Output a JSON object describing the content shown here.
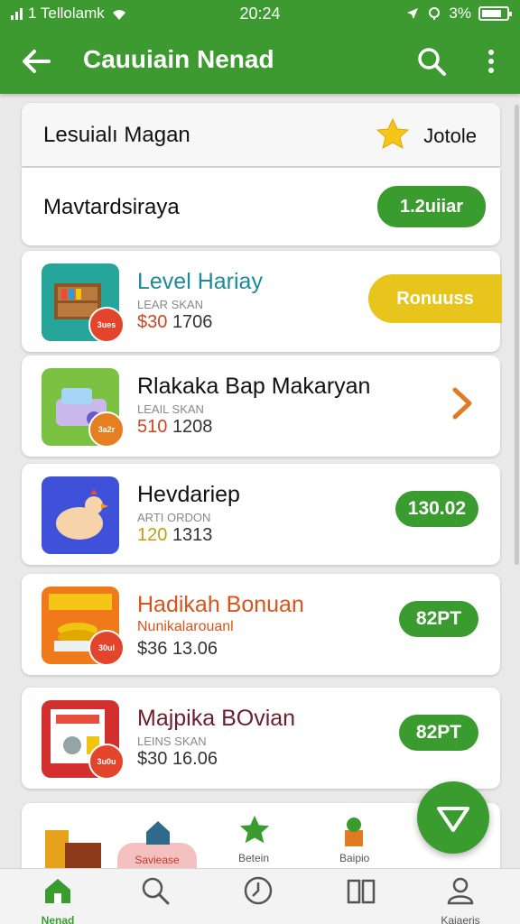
{
  "status": {
    "carrier": "1 Tellolamk",
    "time": "20:24",
    "battery": "3%",
    "battery_level": 0.8,
    "icons": [
      "signal-icon",
      "wifi-icon",
      "location-icon",
      "alarm-icon",
      "battery-icon"
    ]
  },
  "appbar": {
    "title": "Cauuiain Nenad",
    "icons": [
      "back-arrow-icon",
      "search-icon",
      "more-vertical-icon"
    ]
  },
  "header": {
    "label": "Lesuialı Magan",
    "right_label": "Jotole",
    "icon": "star-icon"
  },
  "subheader": {
    "label": "Mavtardsiraya",
    "pill": "1.2uiiar"
  },
  "items": [
    {
      "name": "Level Hariay",
      "sub": "LEAR SKAN",
      "price": "$30",
      "price_amount": "1706",
      "badge": "3ues",
      "action": "Ronuuss",
      "action_type": "yellow-pill",
      "name_color": "#1d8a9a",
      "price_color": "#d0451f"
    },
    {
      "name": "Rlakaka Bap Makaryan",
      "sub": "LEAIL SKAN",
      "price": "510",
      "price_amount": "1208",
      "badge": "3a2r",
      "action": "",
      "action_type": "chevron",
      "name_color": "#111111",
      "price_color": "#d0451f"
    },
    {
      "name": "Hevdariep",
      "sub": "ARTI ORDON",
      "price": "120",
      "price_amount": "1313",
      "badge": "",
      "action": "130.02",
      "action_type": "green-pill",
      "name_color": "#111111",
      "price_color": "#c89a12"
    },
    {
      "name": "Hadikah Bonuan",
      "sub": "Nunikalarouanl",
      "price": "$36",
      "price_amount": "13.06",
      "badge": "30ul",
      "action": "82PT",
      "action_type": "green-pill",
      "name_color": "#d9541c",
      "price_color": "#333333"
    },
    {
      "name": "Majpika BOvian",
      "sub": "LEINS SKAN",
      "price": "$30",
      "price_amount": "16.06",
      "badge": "3u0u",
      "action": "82PT",
      "action_type": "green-pill",
      "name_color": "#6b1e2e",
      "price_color": "#333333"
    }
  ],
  "peek": {
    "labels": [
      "Saviease",
      "Betein",
      "Baipio"
    ]
  },
  "bottomnav": {
    "items": [
      {
        "label": "Nenad",
        "icon": "home-icon"
      },
      {
        "label": "",
        "icon": "search-icon"
      },
      {
        "label": "",
        "icon": "clock-icon"
      },
      {
        "label": "",
        "icon": "book-icon"
      },
      {
        "label": "Kaiaeris",
        "icon": "profile-icon"
      }
    ]
  },
  "colors": {
    "primary": "#3c9a31",
    "accent_yellow": "#e7c51d",
    "accent_orange": "#e07b22",
    "badge_red": "#e2452b"
  }
}
